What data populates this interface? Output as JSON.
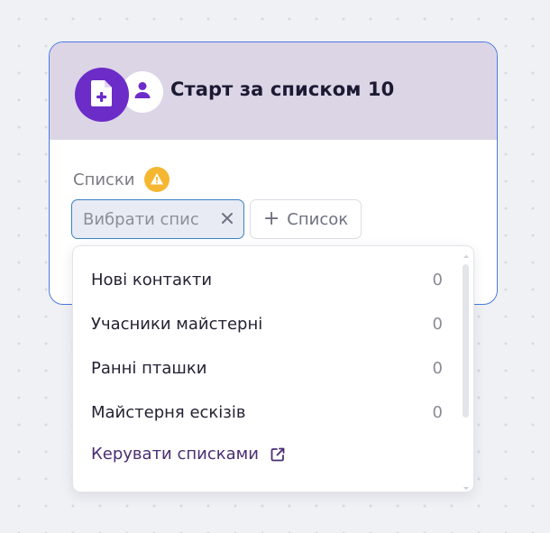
{
  "node": {
    "title": "Старт за списком 10",
    "main_icon": "file-add-icon",
    "secondary_icon": "user-icon"
  },
  "lists_section": {
    "label": "Списки",
    "warning_icon": "warning-triangle-icon"
  },
  "select": {
    "placeholder": "Вибрати спис",
    "clear_icon": "close-icon"
  },
  "add_list_button": {
    "label": "Список",
    "icon": "plus-icon"
  },
  "dropdown": {
    "items": [
      {
        "label": "Нові контакти",
        "count": "0"
      },
      {
        "label": "Учасники майстерні",
        "count": "0"
      },
      {
        "label": "Ранні пташки",
        "count": "0"
      },
      {
        "label": "Майстерня ескізів",
        "count": "0"
      }
    ],
    "manage_link": "Керувати списками",
    "manage_link_icon": "external-link-icon"
  },
  "colors": {
    "accent_purple": "#6c2cc8",
    "header_bg": "#dcd5e6",
    "card_border": "#4a79e0",
    "warning": "#f5b731",
    "link": "#4a2d73"
  }
}
